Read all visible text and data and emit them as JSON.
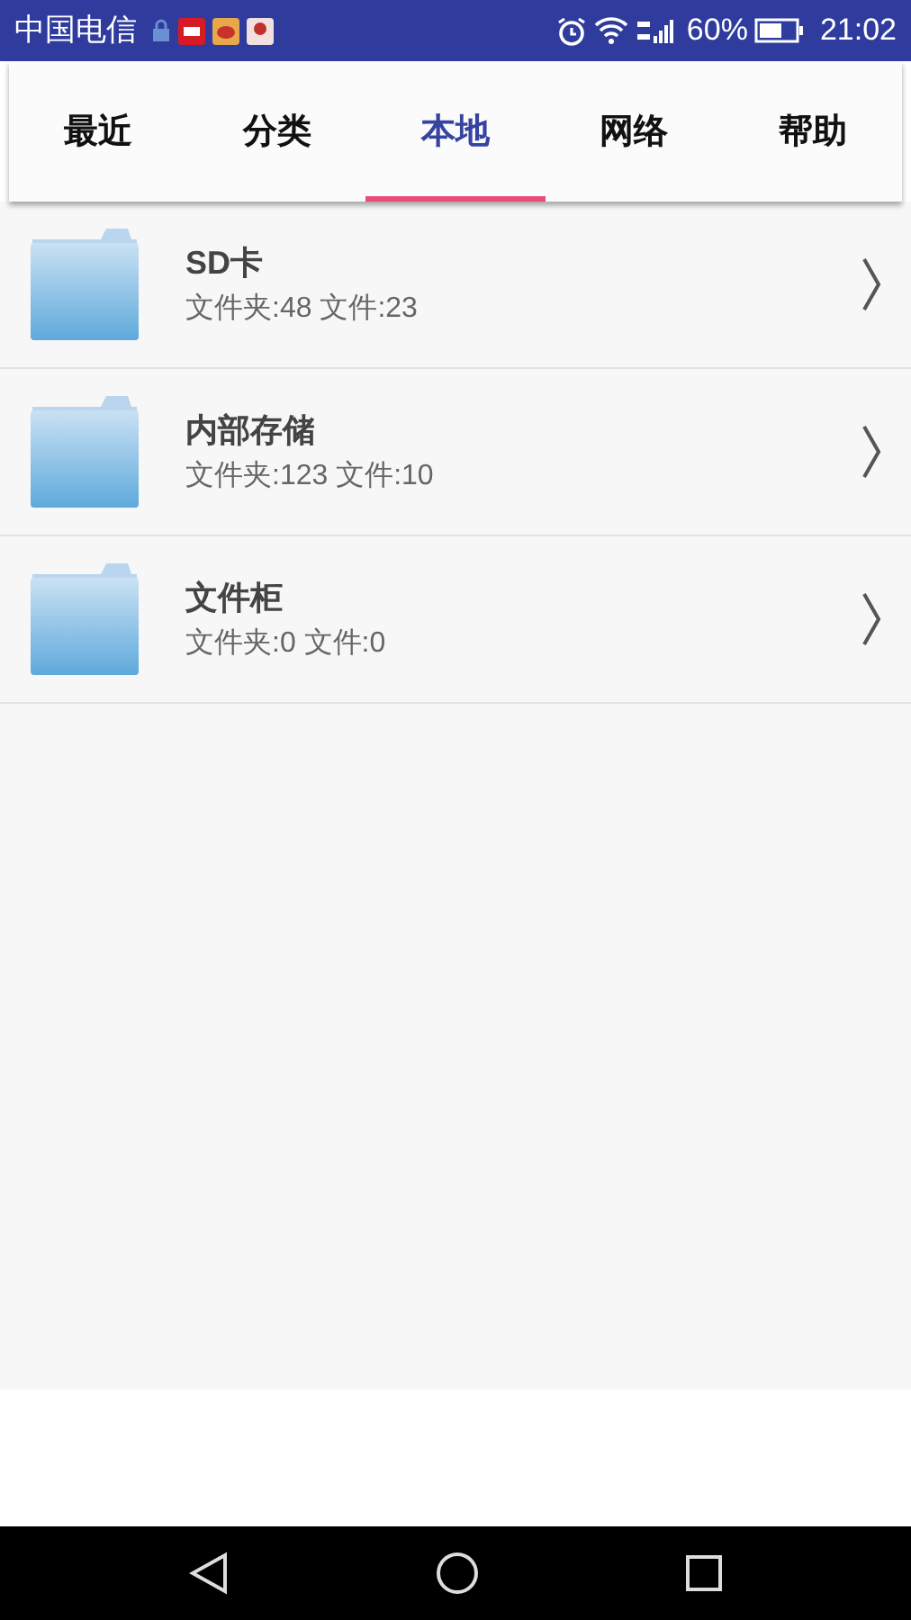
{
  "status_bar": {
    "carrier": "中国电信",
    "battery_text": "60%",
    "time": "21:02"
  },
  "tabs": [
    {
      "label": "最近",
      "selected": false
    },
    {
      "label": "分类",
      "selected": false
    },
    {
      "label": "本地",
      "selected": true
    },
    {
      "label": "网络",
      "selected": false
    },
    {
      "label": "帮助",
      "selected": false
    }
  ],
  "storage_list": [
    {
      "title": "SD卡",
      "detail": "文件夹:48 文件:23"
    },
    {
      "title": "内部存储",
      "detail": "文件夹:123 文件:10"
    },
    {
      "title": "文件柜",
      "detail": "文件夹:0 文件:0"
    }
  ]
}
